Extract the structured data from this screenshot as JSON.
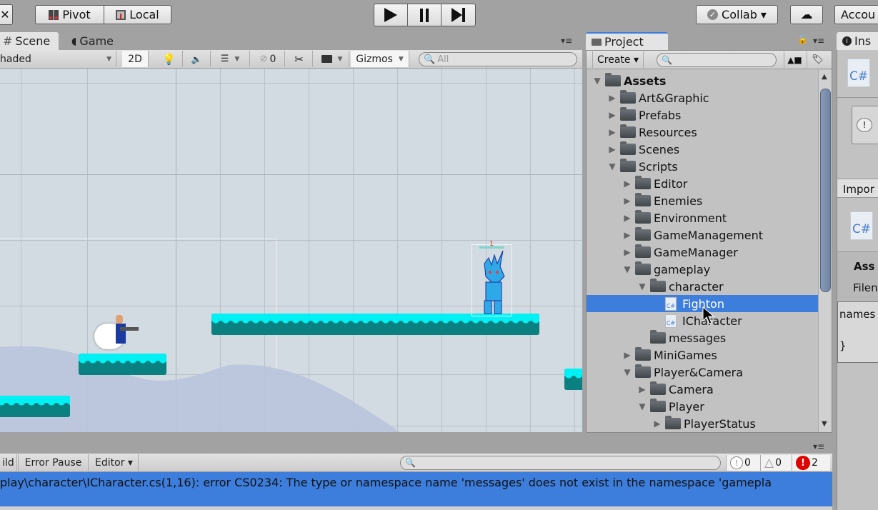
{
  "top_toolbar": {
    "pivot_label": "Pivot",
    "local_label": "Local",
    "play_icon": "play-icon",
    "pause_icon": "pause-icon",
    "step_icon": "step-icon",
    "collab_label": "Collab ▾",
    "account_label": "Accou"
  },
  "scene_panel": {
    "tabs": [
      {
        "label": "Scene",
        "active": true
      },
      {
        "label": "Game",
        "active": false
      }
    ],
    "toolbar": {
      "shading_mode": "haded",
      "mode_2d": "2D",
      "hidden_count": "0",
      "gizmos_label": "Gizmos",
      "search_placeholder": "All"
    },
    "enemy_damage_label": "1"
  },
  "project_panel": {
    "tab_label": "Project",
    "create_label": "Create ▾",
    "search_placeholder": "",
    "tree": [
      {
        "label": "Assets",
        "type": "folder",
        "depth": 0,
        "expanded": true,
        "bold": true
      },
      {
        "label": "Art&Graphic",
        "type": "folder",
        "depth": 1,
        "expanded": false
      },
      {
        "label": "Prefabs",
        "type": "folder",
        "depth": 1,
        "expanded": false
      },
      {
        "label": "Resources",
        "type": "folder",
        "depth": 1,
        "expanded": false
      },
      {
        "label": "Scenes",
        "type": "folder",
        "depth": 1,
        "expanded": false
      },
      {
        "label": "Scripts",
        "type": "folder",
        "depth": 1,
        "expanded": true
      },
      {
        "label": "Editor",
        "type": "folder",
        "depth": 2,
        "expanded": false
      },
      {
        "label": "Enemies",
        "type": "folder",
        "depth": 2,
        "expanded": false
      },
      {
        "label": "Environment",
        "type": "folder",
        "depth": 2,
        "expanded": false
      },
      {
        "label": "GameManagement",
        "type": "folder",
        "depth": 2,
        "expanded": false
      },
      {
        "label": "GameManager",
        "type": "folder",
        "depth": 2,
        "expanded": false
      },
      {
        "label": "gameplay",
        "type": "folder",
        "depth": 2,
        "expanded": true
      },
      {
        "label": "character",
        "type": "folder",
        "depth": 3,
        "expanded": true
      },
      {
        "label": "Fighton",
        "type": "script",
        "depth": 4,
        "selected": true
      },
      {
        "label": "ICharacter",
        "type": "script",
        "depth": 4
      },
      {
        "label": "messages",
        "type": "folder",
        "depth": 3,
        "leaf": true
      },
      {
        "label": "MiniGames",
        "type": "folder",
        "depth": 2,
        "expanded": false
      },
      {
        "label": "Player&Camera",
        "type": "folder",
        "depth": 2,
        "expanded": true
      },
      {
        "label": "Camera",
        "type": "folder",
        "depth": 3,
        "expanded": false
      },
      {
        "label": "Player",
        "type": "folder",
        "depth": 3,
        "expanded": true
      },
      {
        "label": "PlayerStatus",
        "type": "folder",
        "depth": 4,
        "expanded": false
      }
    ]
  },
  "inspector": {
    "tab_label": "Ins",
    "import_label": "Impor",
    "assets_label": "Ass",
    "filename_label": "Filen",
    "code_line1": "names",
    "code_line2": "}"
  },
  "console": {
    "build_label": "ild",
    "error_pause_label": "Error Pause",
    "editor_label": "Editor ▾",
    "info_count": "0",
    "warning_count": "0",
    "error_count": "2",
    "message": "play\\character\\ICharacter.cs(1,16): error CS0234: The type or namespace name 'messages' does not exist in the namespace 'gamepla"
  },
  "colors": {
    "selection": "#3d7edc",
    "editor_bg": "#a2a2a2",
    "platform_top": "#00f0f4",
    "platform_body": "#0b8080",
    "error_red": "#e00000"
  }
}
